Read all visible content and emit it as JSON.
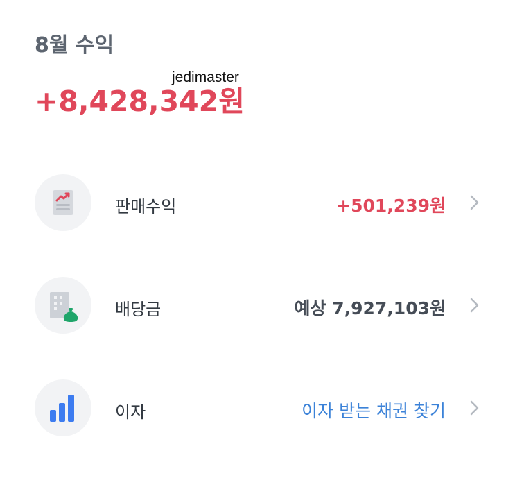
{
  "header": {
    "month_title": "8월 수익",
    "total_amount": "+8,428,342원",
    "watermark": "jedimaster"
  },
  "rows": [
    {
      "label": "판매수익",
      "value": "+501,239원",
      "icon": "sales-report-icon",
      "value_color": "#e0475a"
    },
    {
      "label": "배당금",
      "value": "예상 7,927,103원",
      "icon": "dividend-building-icon",
      "value_color": "#454c56"
    },
    {
      "label": "이자",
      "value": "이자 받는 채권 찾기",
      "icon": "bar-chart-icon",
      "value_color": "#3b82d8"
    }
  ],
  "colors": {
    "accent_red": "#e0475a",
    "accent_blue": "#3b82d8",
    "accent_green": "#1fa56a",
    "text_gray": "#5d6570"
  }
}
